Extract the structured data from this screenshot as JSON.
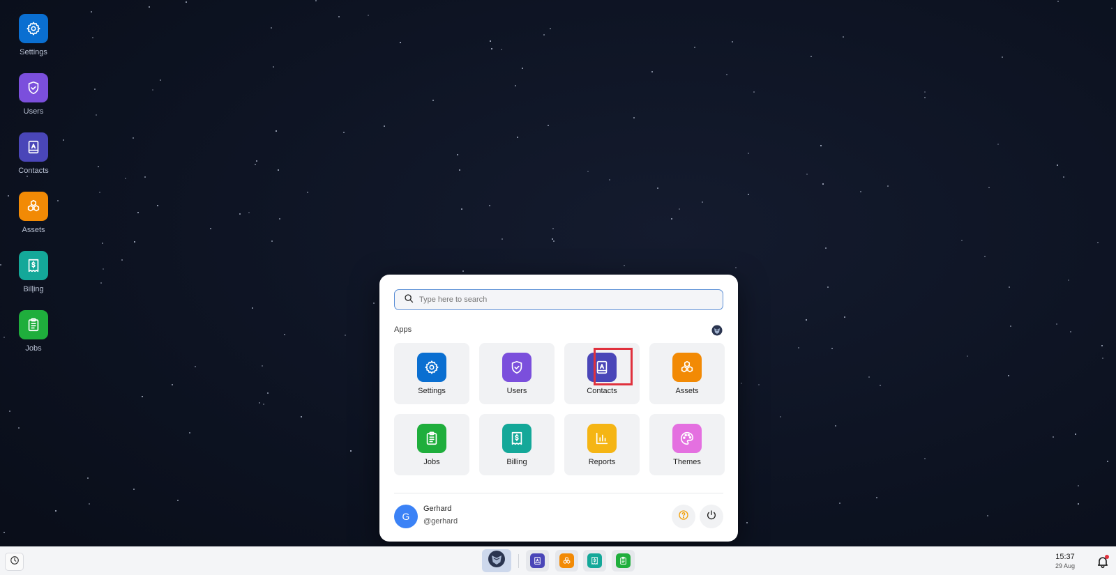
{
  "desktop": {
    "icons": [
      {
        "label": "Settings",
        "icon": "gear-icon",
        "color": "#0a6fd1"
      },
      {
        "label": "Users",
        "icon": "shield-check-icon",
        "color": "#7b4fdc"
      },
      {
        "label": "Contacts",
        "icon": "contact-book-icon",
        "color": "#4a46b8"
      },
      {
        "label": "Assets",
        "icon": "cubes-icon",
        "color": "#f28a05"
      },
      {
        "label": "Billing",
        "icon": "receipt-dollar-icon",
        "color": "#14a899"
      },
      {
        "label": "Jobs",
        "icon": "clipboard-list-icon",
        "color": "#1fae3c"
      }
    ]
  },
  "start_menu": {
    "search": {
      "placeholder": "Type here to search",
      "value": ""
    },
    "apps_label": "Apps",
    "apps": [
      {
        "label": "Settings",
        "icon": "gear-icon",
        "color": "#0a6fd1"
      },
      {
        "label": "Users",
        "icon": "shield-check-icon",
        "color": "#7b4fdc"
      },
      {
        "label": "Contacts",
        "icon": "contact-book-icon",
        "color": "#4a46b8",
        "highlighted": true
      },
      {
        "label": "Assets",
        "icon": "cubes-icon",
        "color": "#f28a05"
      },
      {
        "label": "Jobs",
        "icon": "clipboard-list-icon",
        "color": "#1fae3c"
      },
      {
        "label": "Billing",
        "icon": "receipt-dollar-icon",
        "color": "#14a899"
      },
      {
        "label": "Reports",
        "icon": "bar-chart-icon",
        "color": "#f5b514"
      },
      {
        "label": "Themes",
        "icon": "palette-icon",
        "color": "#e470e0"
      }
    ],
    "user": {
      "avatar_letter": "G",
      "name": "Gerhard",
      "handle": "@gerhard"
    },
    "highlight_color": "#e0313d"
  },
  "taskbar": {
    "pinned": [
      {
        "icon": "contact-book-icon",
        "color": "#4a46b8"
      },
      {
        "icon": "cubes-icon",
        "color": "#f28a05"
      },
      {
        "icon": "receipt-dollar-icon",
        "color": "#14a899"
      },
      {
        "icon": "clipboard-list-icon",
        "color": "#1fae3c"
      }
    ],
    "time": "15:37",
    "date": "29 Aug",
    "notification_dot_color": "#e0313d"
  }
}
